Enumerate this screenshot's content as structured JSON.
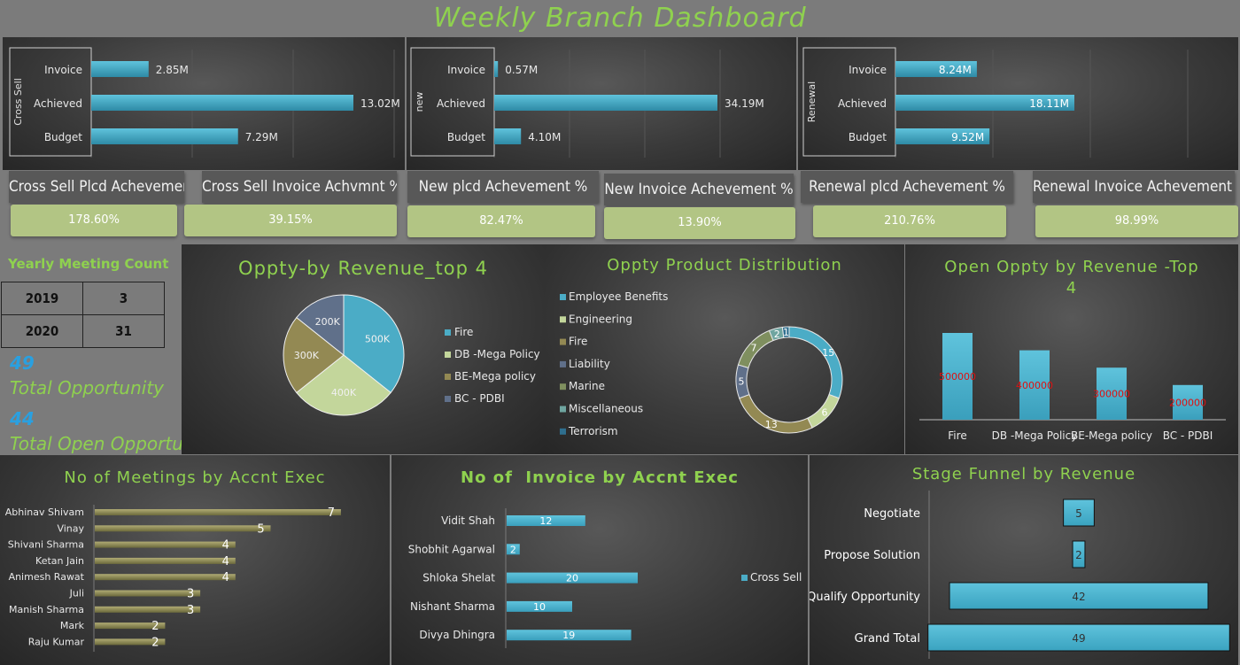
{
  "title": "Weekly Branch Dashboard",
  "top_bars": [
    {
      "axis_label": "Cross Sell",
      "categories": [
        "Invoice",
        "Achieved",
        "Budget"
      ],
      "values": [
        2.85,
        13.02,
        7.29
      ],
      "labels": [
        "2.85M",
        "13.02M",
        "7.29M"
      ]
    },
    {
      "axis_label": "new",
      "categories": [
        "Invoice",
        "Achieved",
        "Budget"
      ],
      "values": [
        0.57,
        34.19,
        4.1
      ],
      "labels": [
        "0.57M",
        "34.19M",
        "4.10M"
      ]
    },
    {
      "axis_label": "Renewal",
      "categories": [
        "Invoice",
        "Achieved",
        "Budget"
      ],
      "values": [
        8.24,
        18.11,
        9.52
      ],
      "labels": [
        "8.24M",
        "18.11M",
        "9.52M"
      ]
    }
  ],
  "kpis": [
    {
      "label": "Cross Sell Plcd Achevement",
      "value": "178.60%"
    },
    {
      "label": "Cross Sell Invoice Achvmnt %",
      "value": "39.15%"
    },
    {
      "label": "New plcd Achevement %",
      "value": "82.47%"
    },
    {
      "label": "New Invoice Achevement %",
      "value": "13.90%"
    },
    {
      "label": "Renewal plcd Achevement %",
      "value": "210.76%"
    },
    {
      "label": "Renewal Invoice Achevement %",
      "value": "98.99%"
    }
  ],
  "meetings": {
    "title": "Yearly Meeting Count",
    "rows": [
      [
        "2019",
        "3"
      ],
      [
        "2020",
        "31"
      ]
    ],
    "total_opportunity_value": "49",
    "total_opportunity_label": "Total Opportunity",
    "total_open_value": "44",
    "total_open_label": "Total Open Opportunity"
  },
  "colors": {
    "accent_green": "#8fd14f",
    "bar_blue": "#4bacc6",
    "olive": "#8a8a58",
    "kpi_green": "#b2c584",
    "value_red": "#e01010"
  },
  "chart_data": [
    {
      "type": "pie",
      "title": "Oppty-by Revenue_top 4",
      "categories": [
        "Fire",
        "DB -Mega Policy",
        "BE-Mega policy",
        "BC - PDBI"
      ],
      "values": [
        500,
        400,
        300,
        200
      ],
      "labels": [
        "500K",
        "400K",
        "300K",
        "200K"
      ],
      "colors": [
        "#4bacc6",
        "#c3d69b",
        "#938953",
        "#60708a"
      ]
    },
    {
      "type": "pie",
      "subtype": "donut",
      "title": "Oppty Product Distribution",
      "categories": [
        "Employee Benefits",
        "Engineering",
        "Fire",
        "Liability",
        "Marine",
        "Miscellaneous",
        "Terrorism"
      ],
      "values": [
        15,
        6,
        13,
        5,
        7,
        2,
        1
      ],
      "colors": [
        "#4bacc6",
        "#c3d69b",
        "#938953",
        "#60708a",
        "#7f8f5f",
        "#6fa5a0",
        "#2f6f8f"
      ]
    },
    {
      "type": "bar",
      "title": "Open Oppty by Revenue -Top 4",
      "categories": [
        "Fire",
        "DB -Mega Policy",
        "BE-Mega policy",
        "BC - PDBI"
      ],
      "values": [
        500000,
        400000,
        300000,
        200000
      ]
    },
    {
      "type": "bar",
      "title": "No of Meetings by Accnt Exec",
      "categories": [
        "Abhinav Shivam",
        "Vinay",
        "Shivani Sharma",
        "Ketan Jain",
        "Animesh Rawat",
        "Juli",
        "Manish Sharma",
        "Mark",
        "Raju Kumar"
      ],
      "values": [
        7,
        5,
        4,
        4,
        4,
        3,
        3,
        2,
        2
      ]
    },
    {
      "type": "bar",
      "title": "No of  Invoice by Accnt Exec",
      "categories": [
        "Vidit Shah",
        "Shobhit Agarwal",
        "Shloka Shelat",
        "Nishant Sharma",
        "Divya Dhingra"
      ],
      "values": [
        12,
        2,
        20,
        10,
        19
      ],
      "series": [
        {
          "name": "Cross Sell",
          "values": [
            12,
            2,
            20,
            10,
            19
          ]
        }
      ]
    },
    {
      "type": "bar",
      "title": "Stage Funnel by Revenue",
      "categories": [
        "Negotiate",
        "Propose Solution",
        "Qualify Opportunity",
        "Grand Total"
      ],
      "values": [
        5,
        2,
        42,
        49
      ]
    }
  ]
}
